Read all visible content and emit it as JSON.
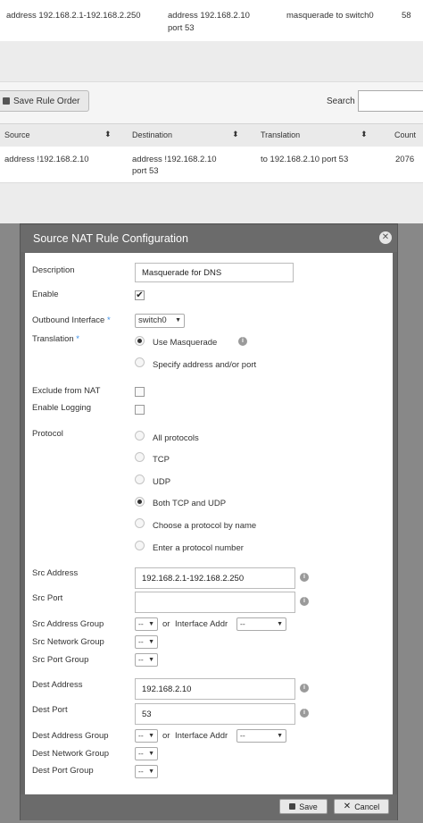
{
  "background": {
    "top_row": {
      "source": "address 192.168.2.1-192.168.2.250",
      "destination_line1": "address 192.168.2.10",
      "destination_line2": "port 53",
      "translation": "masquerade to switch0",
      "count": "58"
    },
    "save_order_label": "Save Rule Order",
    "search_label": "Search",
    "search_value": "",
    "columns": [
      "Source",
      "Destination",
      "Translation",
      "Count"
    ],
    "row": {
      "source": "address !192.168.2.10",
      "destination_line1": "address !192.168.2.10",
      "destination_line2": "port 53",
      "translation": "to 192.168.2.10 port 53",
      "count": "2076"
    }
  },
  "dialog": {
    "title": "Source NAT Rule Configuration",
    "description_label": "Description",
    "description_value": "Masquerade for DNS",
    "enable_label": "Enable",
    "enable_checked": true,
    "outbound_label": "Outbound Interface",
    "outbound_value": "switch0",
    "translation_label": "Translation",
    "translation_options": [
      "Use Masquerade",
      "Specify address and/or port"
    ],
    "translation_selected": 0,
    "exclude_label": "Exclude from NAT",
    "logging_label": "Enable Logging",
    "protocol_label": "Protocol",
    "protocol_options": [
      "All protocols",
      "TCP",
      "UDP",
      "Both TCP and UDP",
      "Choose a protocol by name",
      "Enter a protocol number"
    ],
    "protocol_selected": 3,
    "src_address_label": "Src Address",
    "src_address_value": "192.168.2.1-192.168.2.250",
    "src_port_label": "Src Port",
    "src_port_value": "",
    "src_address_group_label": "Src Address Group",
    "src_network_group_label": "Src Network Group",
    "src_port_group_label": "Src Port Group",
    "dest_address_label": "Dest Address",
    "dest_address_value": "192.168.2.10",
    "dest_port_label": "Dest Port",
    "dest_port_value": "53",
    "dest_address_group_label": "Dest Address Group",
    "dest_network_group_label": "Dest Network Group",
    "dest_port_group_label": "Dest Port Group",
    "group_select_value": "--",
    "or_label": "or",
    "interface_addr_label": "Interface Addr",
    "interface_addr_value": "--",
    "save_label": "Save",
    "cancel_label": "Cancel"
  },
  "colors": {
    "required_star": "#3a8ee6",
    "dialog_header": "#6b6b6b"
  }
}
